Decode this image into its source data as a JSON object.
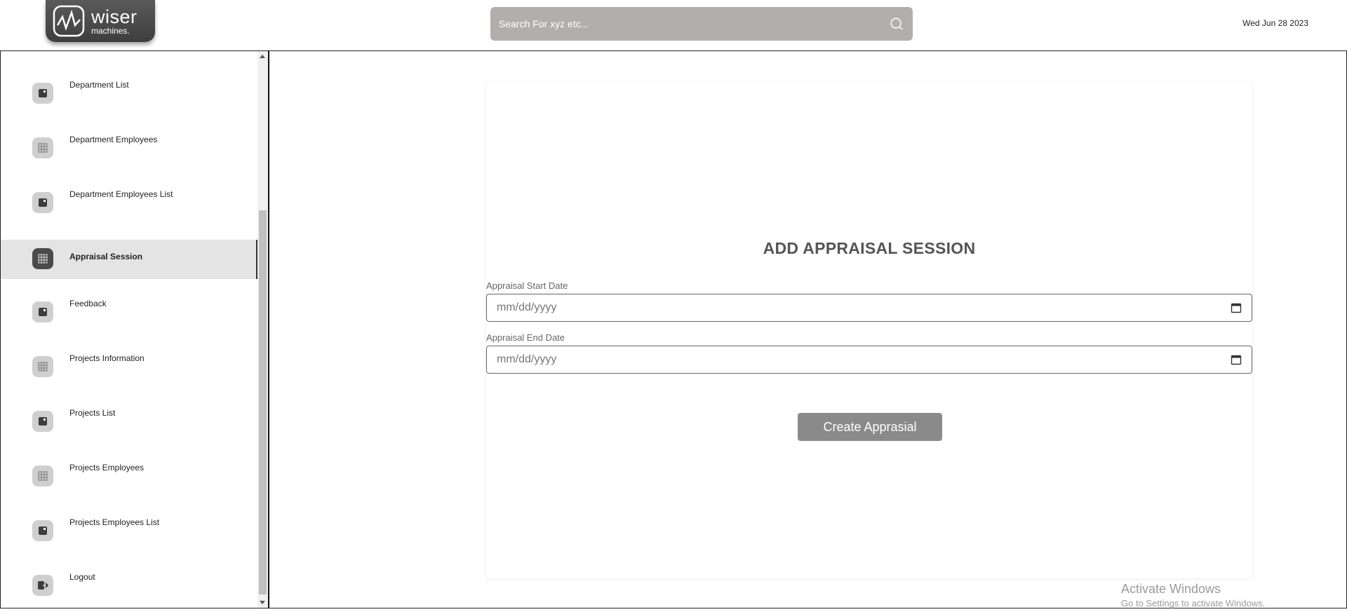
{
  "header": {
    "logo_text": "wiser",
    "logo_subtext": "machines.",
    "search_placeholder": "Search For xyz etc...",
    "date": "Wed Jun 28 2023"
  },
  "sidebar": {
    "items": [
      {
        "label": "Department List",
        "icon": "square-icon",
        "active": false
      },
      {
        "label": "Department Employees",
        "icon": "grid-icon",
        "active": false
      },
      {
        "label": "Department Employees List",
        "icon": "square-icon",
        "active": false
      },
      {
        "label": "Appraisal Session",
        "icon": "grid-icon",
        "active": true
      },
      {
        "label": "Feedback",
        "icon": "square-icon",
        "active": false
      },
      {
        "label": "Projects Information",
        "icon": "grid-icon",
        "active": false
      },
      {
        "label": "Projects List",
        "icon": "square-icon",
        "active": false
      },
      {
        "label": "Projects Employees",
        "icon": "grid-icon",
        "active": false
      },
      {
        "label": "Projects Employees List",
        "icon": "square-icon",
        "active": false
      },
      {
        "label": "Logout",
        "icon": "logout-icon",
        "active": false
      }
    ]
  },
  "form": {
    "title": "ADD APPRAISAL SESSION",
    "start_label": "Appraisal Start Date",
    "start_value": "mm/dd/yyyy",
    "end_label": "Appraisal End Date",
    "end_value": "mm/dd/yyyy",
    "submit_label": "Create Apprasial"
  },
  "watermark": {
    "title": "Activate Windows",
    "subtitle": "Go to Settings to activate Windows."
  }
}
